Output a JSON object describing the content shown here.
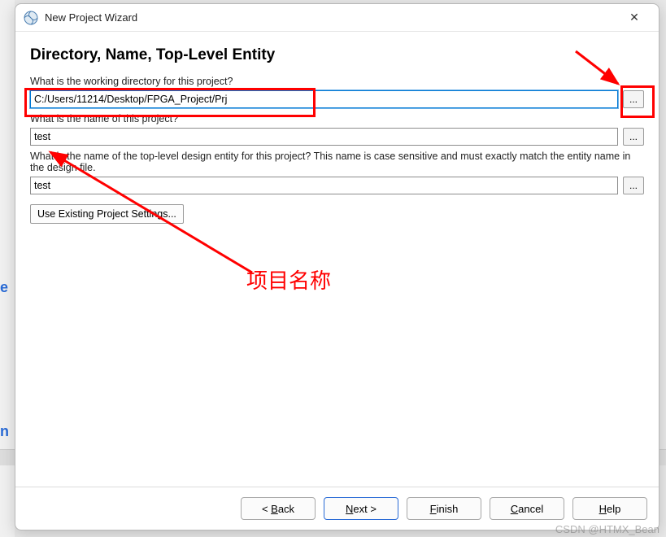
{
  "window": {
    "title": "New Project Wizard",
    "close_glyph": "✕"
  },
  "page": {
    "heading": "Directory, Name, Top-Level Entity",
    "label_dir": "What is the working directory for this project?",
    "label_name": "What is the name of this project?",
    "label_entity": "What is the name of the top-level design entity for this project? This name is case sensitive and must exactly match the entity name in the design file.",
    "input_dir": "C:/Users/11214/Desktop/FPGA_Project/Prj",
    "input_name": "test",
    "input_entity": "test",
    "browse_glyph": "...",
    "settings_btn": "Use Existing Project Settings..."
  },
  "nav": {
    "back": "< Back",
    "next": "Next >",
    "finish": "Finish",
    "cancel": "Cancel",
    "help": "Help"
  },
  "annotations": {
    "proj_name": "项目名称"
  },
  "watermark": "CSDN @HTMX_Bean"
}
